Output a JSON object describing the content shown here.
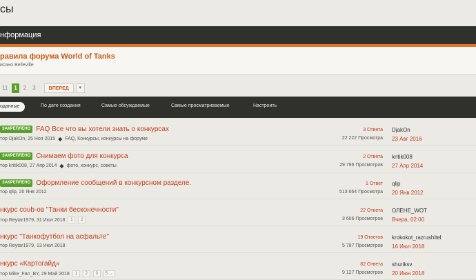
{
  "page": {
    "title": "сы"
  },
  "info": {
    "title": "нформация"
  },
  "notice": {
    "title": "равила форума World of Tanks",
    "subtitle": "исано Belleville"
  },
  "pager": {
    "pages": [
      "11",
      "1",
      "2",
      "3"
    ],
    "active_index": 1,
    "next_label": "ВПЕРЕД",
    "next_arrow": "▾"
  },
  "sort": {
    "items": [
      "оданные",
      "По дате создания",
      "Самые обсуждаемые",
      "Самые просматриваемые",
      "Настроить"
    ]
  },
  "topics": [
    {
      "badge": "ЗАКРЕПЛЕНО",
      "title": "FAQ Все что вы хотели знать о конкурсах",
      "meta": "тор DjakOn, 25 Ноя 2015",
      "tags": "FAQ, Конкурсы, конкурсы на форуме",
      "pages": [],
      "replies": "3 Ответа",
      "views": "22 222 Просмотра",
      "last_user": "DjakOn",
      "last_date": "23 Авг 2016"
    },
    {
      "badge": "ЗАКРЕПЛЕНО",
      "title": "Снимаем фото для конкурса",
      "meta": "тор kritik008, 27 Апр 2014",
      "tags": "фото, конкурс, советы",
      "pages": [],
      "replies": "2 Ответа",
      "views": "29 796 Просмотров",
      "last_user": "kritik008",
      "last_date": "27 Апр 2014"
    },
    {
      "badge": "ЗАКРЕПЛЕНО",
      "title": "Оформление сообщений в конкурсном разделе.",
      "meta": "тор qlip, 20 Янв 2012",
      "tags": "",
      "pages": [],
      "replies": "1 Ответ",
      "views": "513 664 Просмотра",
      "last_user": "qlip",
      "last_date": "20 Янв 2012"
    },
    {
      "badge": "",
      "title": "нкурс coub-ов \"Танки бесконечности\"",
      "meta": "тор Reytar1979, 31 Июл 2018",
      "tags": "",
      "pages": [
        "1",
        "2"
      ],
      "replies": "22 Ответа",
      "views": "3 606 Просмотров",
      "last_user": "ОЛЕНЕ_WOT",
      "last_date": "Вчера, 02:00"
    },
    {
      "badge": "",
      "title": "нкурс \"Танкофутбол на асфальте\"",
      "meta": "тор Reytar1979, 13 Июл 2018",
      "tags": "",
      "pages": [],
      "replies": "19 Ответов",
      "views": "5 787 Просмотров",
      "last_user": "krokokot_razrushitel",
      "last_date": "16 Июл 2018"
    },
    {
      "badge": "",
      "title": "нкурс «Картогайд»",
      "meta": "тор Mike_Fan_BY, 29 Май 2018",
      "tags": "",
      "pages": [
        "1",
        "2",
        "3",
        "5 →"
      ],
      "replies": "82 Ответа",
      "views": "9 127 Просмотров",
      "last_user": "shuriksv",
      "last_date": "20 Июн 2018"
    }
  ],
  "colors": {
    "accent": "#c43e1c",
    "pinned": "#5aa02c",
    "dark_bar": "#30312d",
    "orange_line": "#e07428"
  }
}
